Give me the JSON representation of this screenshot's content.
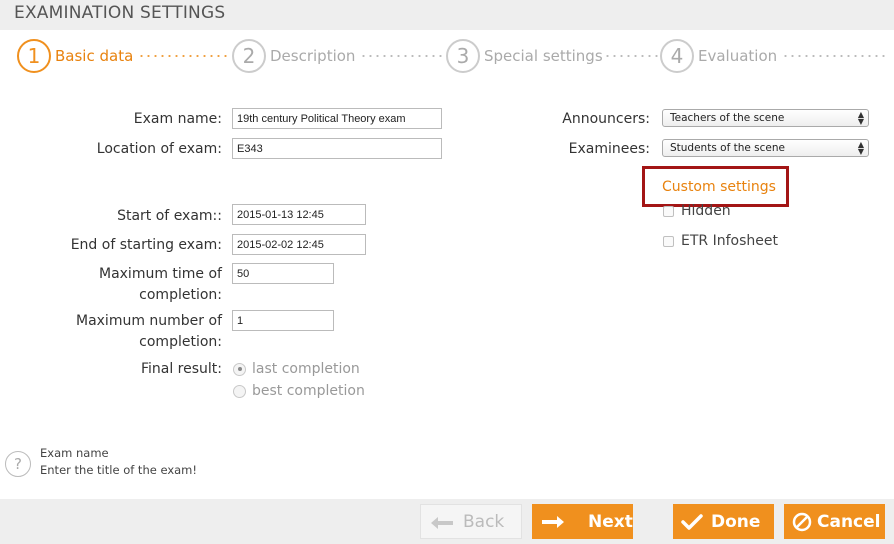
{
  "header": {
    "title": "EXAMINATION SETTINGS"
  },
  "steps": [
    {
      "number": "1",
      "label": "Basic data"
    },
    {
      "number": "2",
      "label": "Description"
    },
    {
      "number": "3",
      "label": "Special settings"
    },
    {
      "number": "4",
      "label": "Evaluation"
    }
  ],
  "form": {
    "exam_name": {
      "label": "Exam name:",
      "value": "19th century Political Theory exam"
    },
    "location": {
      "label": "Location of exam:",
      "value": "E343"
    },
    "start": {
      "label": "Start of exam::",
      "value": "2015-01-13 12:45"
    },
    "end_start": {
      "label": "End of starting exam:",
      "value": "2015-02-02 12:45"
    },
    "max_time": {
      "label": "Maximum time of completion:",
      "value": "50"
    },
    "max_number": {
      "label": "Maximum number of completion:",
      "value": "1"
    },
    "final_result": {
      "label": "Final result:",
      "options": [
        "last completion",
        "best completion"
      ],
      "selected": "last completion"
    },
    "announcers": {
      "label": "Announcers:",
      "value": "Teachers of the scene"
    },
    "examinees": {
      "label": "Examinees:",
      "value": "Students of the scene"
    },
    "custom_settings": {
      "title": "Custom settings",
      "hidden_label": "Hidden",
      "etr_label": "ETR Infosheet"
    }
  },
  "help": {
    "icon": "question-icon",
    "glyph": "?",
    "title": "Exam name",
    "text": "Enter the title of the exam!"
  },
  "buttons": {
    "back": "Back",
    "next": "Next",
    "done": "Done",
    "cancel": "Cancel"
  },
  "colors": {
    "accent": "#f0901e",
    "highlight_border": "#a31515",
    "disabled": "#bbbbbb"
  }
}
